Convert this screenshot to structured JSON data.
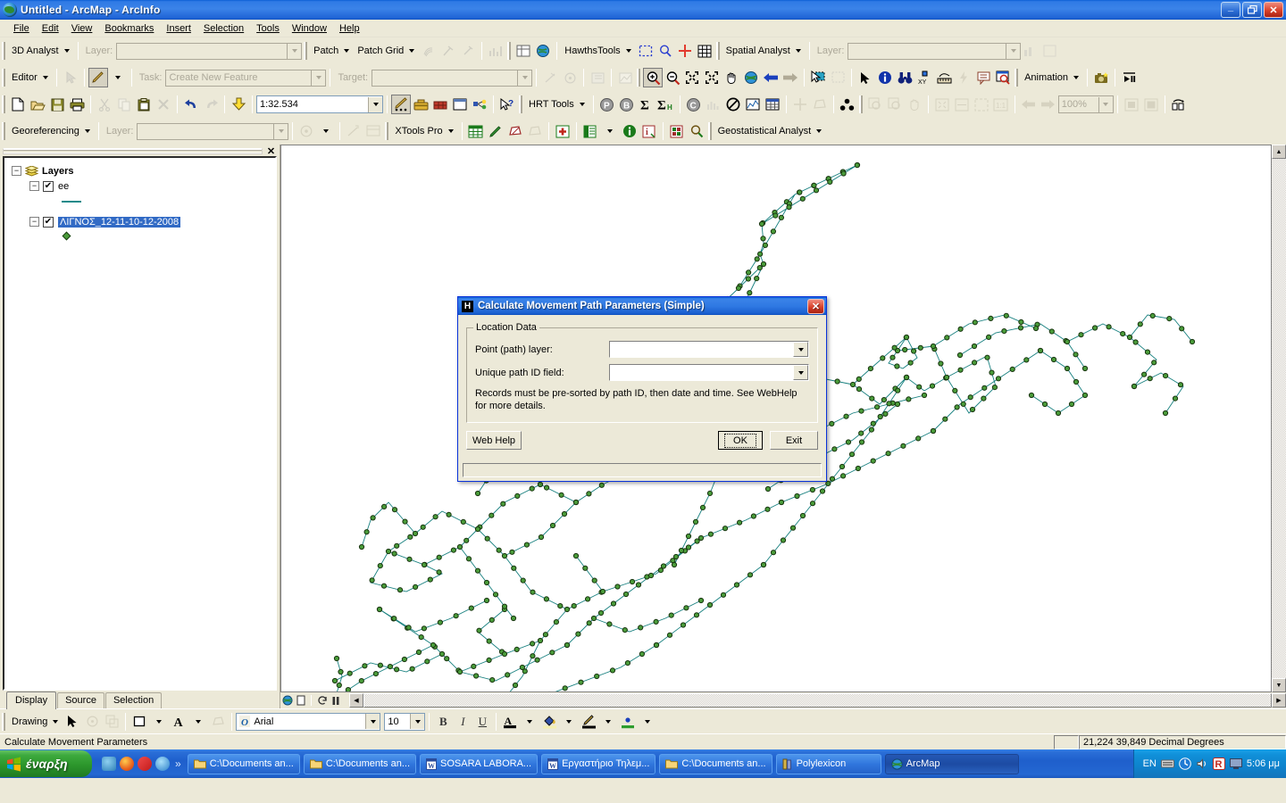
{
  "window": {
    "title": "Untitled - ArcMap - ArcInfo",
    "app_icon": "globe-icon",
    "minimize": "_",
    "maximize": "❐",
    "close": "✕"
  },
  "menubar": {
    "items": [
      {
        "label": "File"
      },
      {
        "label": "Edit"
      },
      {
        "label": "View"
      },
      {
        "label": "Bookmarks"
      },
      {
        "label": "Insert"
      },
      {
        "label": "Selection"
      },
      {
        "label": "Tools"
      },
      {
        "label": "Window"
      },
      {
        "label": "Help"
      }
    ]
  },
  "toolbars": {
    "row1": {
      "analyst3d_label": "3D Analyst",
      "layer_label": "Layer:",
      "layer_value": "",
      "patch_label": "Patch",
      "patchgrid_label": "Patch Grid",
      "hawthstools_label": "HawthsTools",
      "spatial_analyst_label": "Spatial Analyst",
      "spatial_layer_label": "Layer:",
      "spatial_layer_value": ""
    },
    "row2": {
      "editor_label": "Editor",
      "task_label": "Task:",
      "task_value": "Create New Feature",
      "target_label": "Target:",
      "target_value": "",
      "animation_label": "Animation"
    },
    "row3": {
      "scale_value": "1:32.534",
      "hrt_tools_label": "HRT Tools",
      "zoom_value": "100%"
    },
    "row4": {
      "georeferencing_label": "Georeferencing",
      "geo_layer_label": "Layer:",
      "geo_layer_value": "",
      "xtools_label": "XTools Pro",
      "geostatistical_label": "Geostatistical Analyst"
    }
  },
  "toc": {
    "close_icon": "✕",
    "root_label": "Layers",
    "items": [
      {
        "label": "ee",
        "checked": true,
        "symbol": "line",
        "selected": false
      },
      {
        "label": "ΛΙΓΝΟΣ_12-11-10-12-2008",
        "checked": true,
        "symbol": "point",
        "selected": true
      }
    ],
    "tabs": [
      {
        "label": "Display",
        "active": true
      },
      {
        "label": "Source",
        "active": false
      },
      {
        "label": "Selection",
        "active": false
      }
    ]
  },
  "dialog": {
    "icon_letter": "H",
    "title": "Calculate Movement Path Parameters (Simple)",
    "close_label": "✕",
    "group_title": "Location Data",
    "fields": [
      {
        "label": "Point (path) layer:",
        "value": "",
        "placeholder": ""
      },
      {
        "label": "Unique path ID field:",
        "value": "",
        "placeholder": ""
      }
    ],
    "note": "Records must be pre-sorted by path ID, then date and time. See WebHelp for more details.",
    "buttons": {
      "web_help": "Web Help",
      "ok": "OK",
      "exit": "Exit"
    },
    "status": ""
  },
  "statusbar": {
    "message": "Calculate Movement Parameters",
    "coordinates": "21,224  39,849 Decimal Degrees"
  },
  "drawing_toolbar": {
    "drawing_label": "Drawing",
    "font_family_value": "Arial",
    "font_size_value": "10",
    "bold": "B",
    "italic": "I",
    "underline": "U",
    "font_color": "A",
    "fill_color": "fill-color-icon",
    "line_color": "line-color-icon",
    "marker_color": "marker-color-icon"
  },
  "taskbar": {
    "start_label": "έναρξη",
    "quick_launch": [
      "show-desktop-icon",
      "firefox-icon",
      "opera-icon",
      "ie-icon"
    ],
    "overflow": "»",
    "tasks": [
      {
        "label": "C:\\Documents an...",
        "icon": "folder-icon",
        "active": false
      },
      {
        "label": "C:\\Documents an...",
        "icon": "folder-icon",
        "active": false
      },
      {
        "label": "SOSARA LABORA...",
        "icon": "word-icon",
        "active": false
      },
      {
        "label": "Εργαστήριο Τηλεμ...",
        "icon": "word-icon",
        "active": false
      },
      {
        "label": "C:\\Documents an...",
        "icon": "folder-icon",
        "active": false
      },
      {
        "label": "Polylexicon",
        "icon": "book-icon",
        "active": false
      },
      {
        "label": "ArcMap",
        "icon": "globe-icon",
        "active": true
      }
    ],
    "language": "EN",
    "clock": "5:06 μμ",
    "tray_icons": [
      "keyboard-icon",
      "volume-icon",
      "network-icon",
      "antivirus-icon",
      "display-icon"
    ]
  },
  "map": {
    "layer_line_color": "#17807f",
    "layer_point_fill": "#4a9c3a",
    "layer_point_stroke": "#18340f",
    "background": "#ffffff"
  },
  "colors": {
    "titlebar_blue": "#2f7ae5",
    "chrome": "#ece9d8",
    "selection_blue": "#316ac5",
    "teal": "#17807f",
    "green": "#4a9c3a"
  }
}
